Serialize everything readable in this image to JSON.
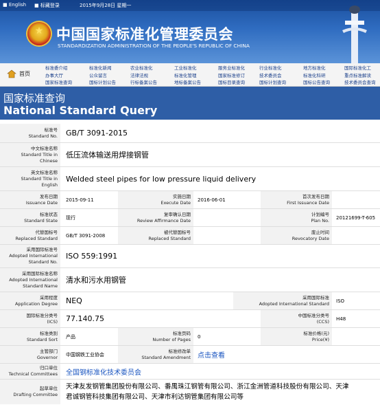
{
  "topbar": {
    "english": "English",
    "bookmark": "标藏登录",
    "date": "2015年9月28日 星期一"
  },
  "site": {
    "title_cn": "中国国家标准化管理委员会",
    "title_en": "STANDARDIZATION ADMINISTRATION OF THE PEOPLE'S REPUBLIC OF CHINA"
  },
  "nav": {
    "home": "首页",
    "row1": [
      "标准委介绍",
      "标准化新闻",
      "农业标准化",
      "工业标准化",
      "服务业标准化",
      "行业标准化",
      "地方标准化",
      "国际标准化工"
    ],
    "row2": [
      "办事大厅",
      "公众留言",
      "法律法规",
      "标准化管理",
      "国家标准修订",
      "技术委员会",
      "标准化科研",
      "重点标准解读"
    ],
    "row3": [
      "国家标准查询",
      "国标计划公告",
      "行标备案公告",
      "地标备案公告",
      "国标目录查询",
      "国标计划查询",
      "国标公告查询",
      "技术委员会查询"
    ]
  },
  "header": {
    "title_cn": "国家标准查询",
    "title_en": "National Standard Query"
  },
  "labels": {
    "std_no": [
      "标准号",
      "Standard No."
    ],
    "title_cn": [
      "中文标准名称",
      "Standard Title in",
      "Chinese"
    ],
    "title_en": [
      "英文标准名称",
      "Standard Title in",
      "English"
    ],
    "issuance": [
      "发布日期",
      "Issuance Date"
    ],
    "execute": [
      "实施日期",
      "Execute Date"
    ],
    "first_issuance": [
      "首次发布日期",
      "First Issuance Date"
    ],
    "state": [
      "标准状态",
      "Standard State"
    ],
    "review": [
      "复审确认日期",
      "Review Affirmance Date"
    ],
    "plan": [
      "计划编号",
      "Plan No."
    ],
    "replaced": [
      "代替国标号",
      "Replaced Standard"
    ],
    "replaced_by": [
      "被代替国标号",
      "Replaced Standard"
    ],
    "revocatory": [
      "废止时间",
      "Revocatory Date"
    ],
    "adopted_no": [
      "采用国际标准号",
      "Adopted International",
      "Standard No."
    ],
    "adopted_name": [
      "采用国际标准名称",
      "Adopted International",
      "Standard Name"
    ],
    "degree": [
      "采用程度",
      "Application Degree"
    ],
    "adopted_std": [
      "采用国际标准",
      "Adopted International Standard"
    ],
    "ics": [
      "国际标准分类号",
      "(ICS)"
    ],
    "ccs": [
      "中国标准分类号",
      "(CCS)"
    ],
    "sort": [
      "标准类别",
      "Standard Sort"
    ],
    "pages": [
      "标准页码",
      "Number of Pages"
    ],
    "price": [
      "标准价格(元)",
      "Price(¥)"
    ],
    "governor": [
      "主管部门",
      "Governor"
    ],
    "amendment": [
      "标准修改单",
      "Standard Amendment"
    ],
    "committees": [
      "归口单位",
      "Technical Committees"
    ],
    "drafting": [
      "起草单位",
      "Drafting Committee"
    ]
  },
  "values": {
    "std_no": "GB/T 3091-2015",
    "title_cn": "低压流体输送用焊接钢管",
    "title_en": "Welded steel pipes for low pressure liquid delivery",
    "issuance": "2015-09-11",
    "execute": "2016-06-01",
    "first_issuance": "",
    "state": "现行",
    "review": "",
    "plan": "20121699-T-605",
    "replaced": "GB/T 3091-2008",
    "replaced_by": "",
    "revocatory": "",
    "adopted_no": "ISO 559:1991",
    "adopted_name": "清水和污水用钢管",
    "degree": "NEQ",
    "adopted_std": "ISO",
    "ics": "77.140.75",
    "ccs": "H48",
    "sort": "产品",
    "pages": "0",
    "price": "",
    "governor": "中国钢铁工业协会",
    "amendment": "点击查看",
    "committees": "全国钢标准化技术委员会",
    "drafting_line1": "天津友发钢管集团股份有限公司、番禺珠江钢管有限公司、浙江金洲管道科技股份有限公司、天津",
    "drafting_line2": "君诚钢管科技集团有限公司、天津市利达钢管集团有限公司等"
  },
  "colors": {
    "header_blue": "#2e5ea6",
    "label_bg": "#f2f2f2",
    "link": "#1a55c0"
  }
}
